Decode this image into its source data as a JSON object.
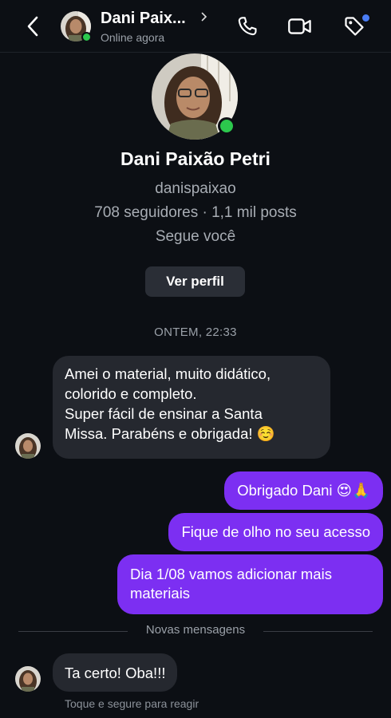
{
  "header": {
    "name": "Dani Paix...",
    "status": "Online agora"
  },
  "profile": {
    "name": "Dani Paixão Petri",
    "username": "danispaixao",
    "stats": "708 seguidores · 1,1 mil posts",
    "follows": "Segue você",
    "view_button": "Ver perfil"
  },
  "timestamp": "ONTEM, 22:33",
  "messages": [
    {
      "from": "them",
      "lines": [
        "Amei o material, muito didático,",
        "colorido e completo.",
        "Super fácil de ensinar a Santa",
        "Missa. Parabéns e obrigada! ☺️"
      ]
    },
    {
      "from": "me",
      "lines": [
        "Obrigado Dani 😍🙏"
      ]
    },
    {
      "from": "me",
      "lines": [
        "Fique de olho no seu acesso"
      ]
    },
    {
      "from": "me",
      "lines": [
        "Dia 1/08 vamos adicionar mais",
        "materiais"
      ]
    },
    {
      "from": "them",
      "lines": [
        "Ta certo! Oba!!!"
      ]
    }
  ],
  "new_messages_label": "Novas mensagens",
  "hint": "Toque e segure para reagir",
  "colors": {
    "background": "#0c0f14",
    "incoming_bubble": "#25282f",
    "outgoing_bubble": "#7c2ff2",
    "online": "#2cc84d",
    "notification_dot": "#4a7df5"
  },
  "icons": [
    "back-arrow-icon",
    "chevron-right-icon",
    "phone-icon",
    "video-camera-icon",
    "tag-icon"
  ]
}
